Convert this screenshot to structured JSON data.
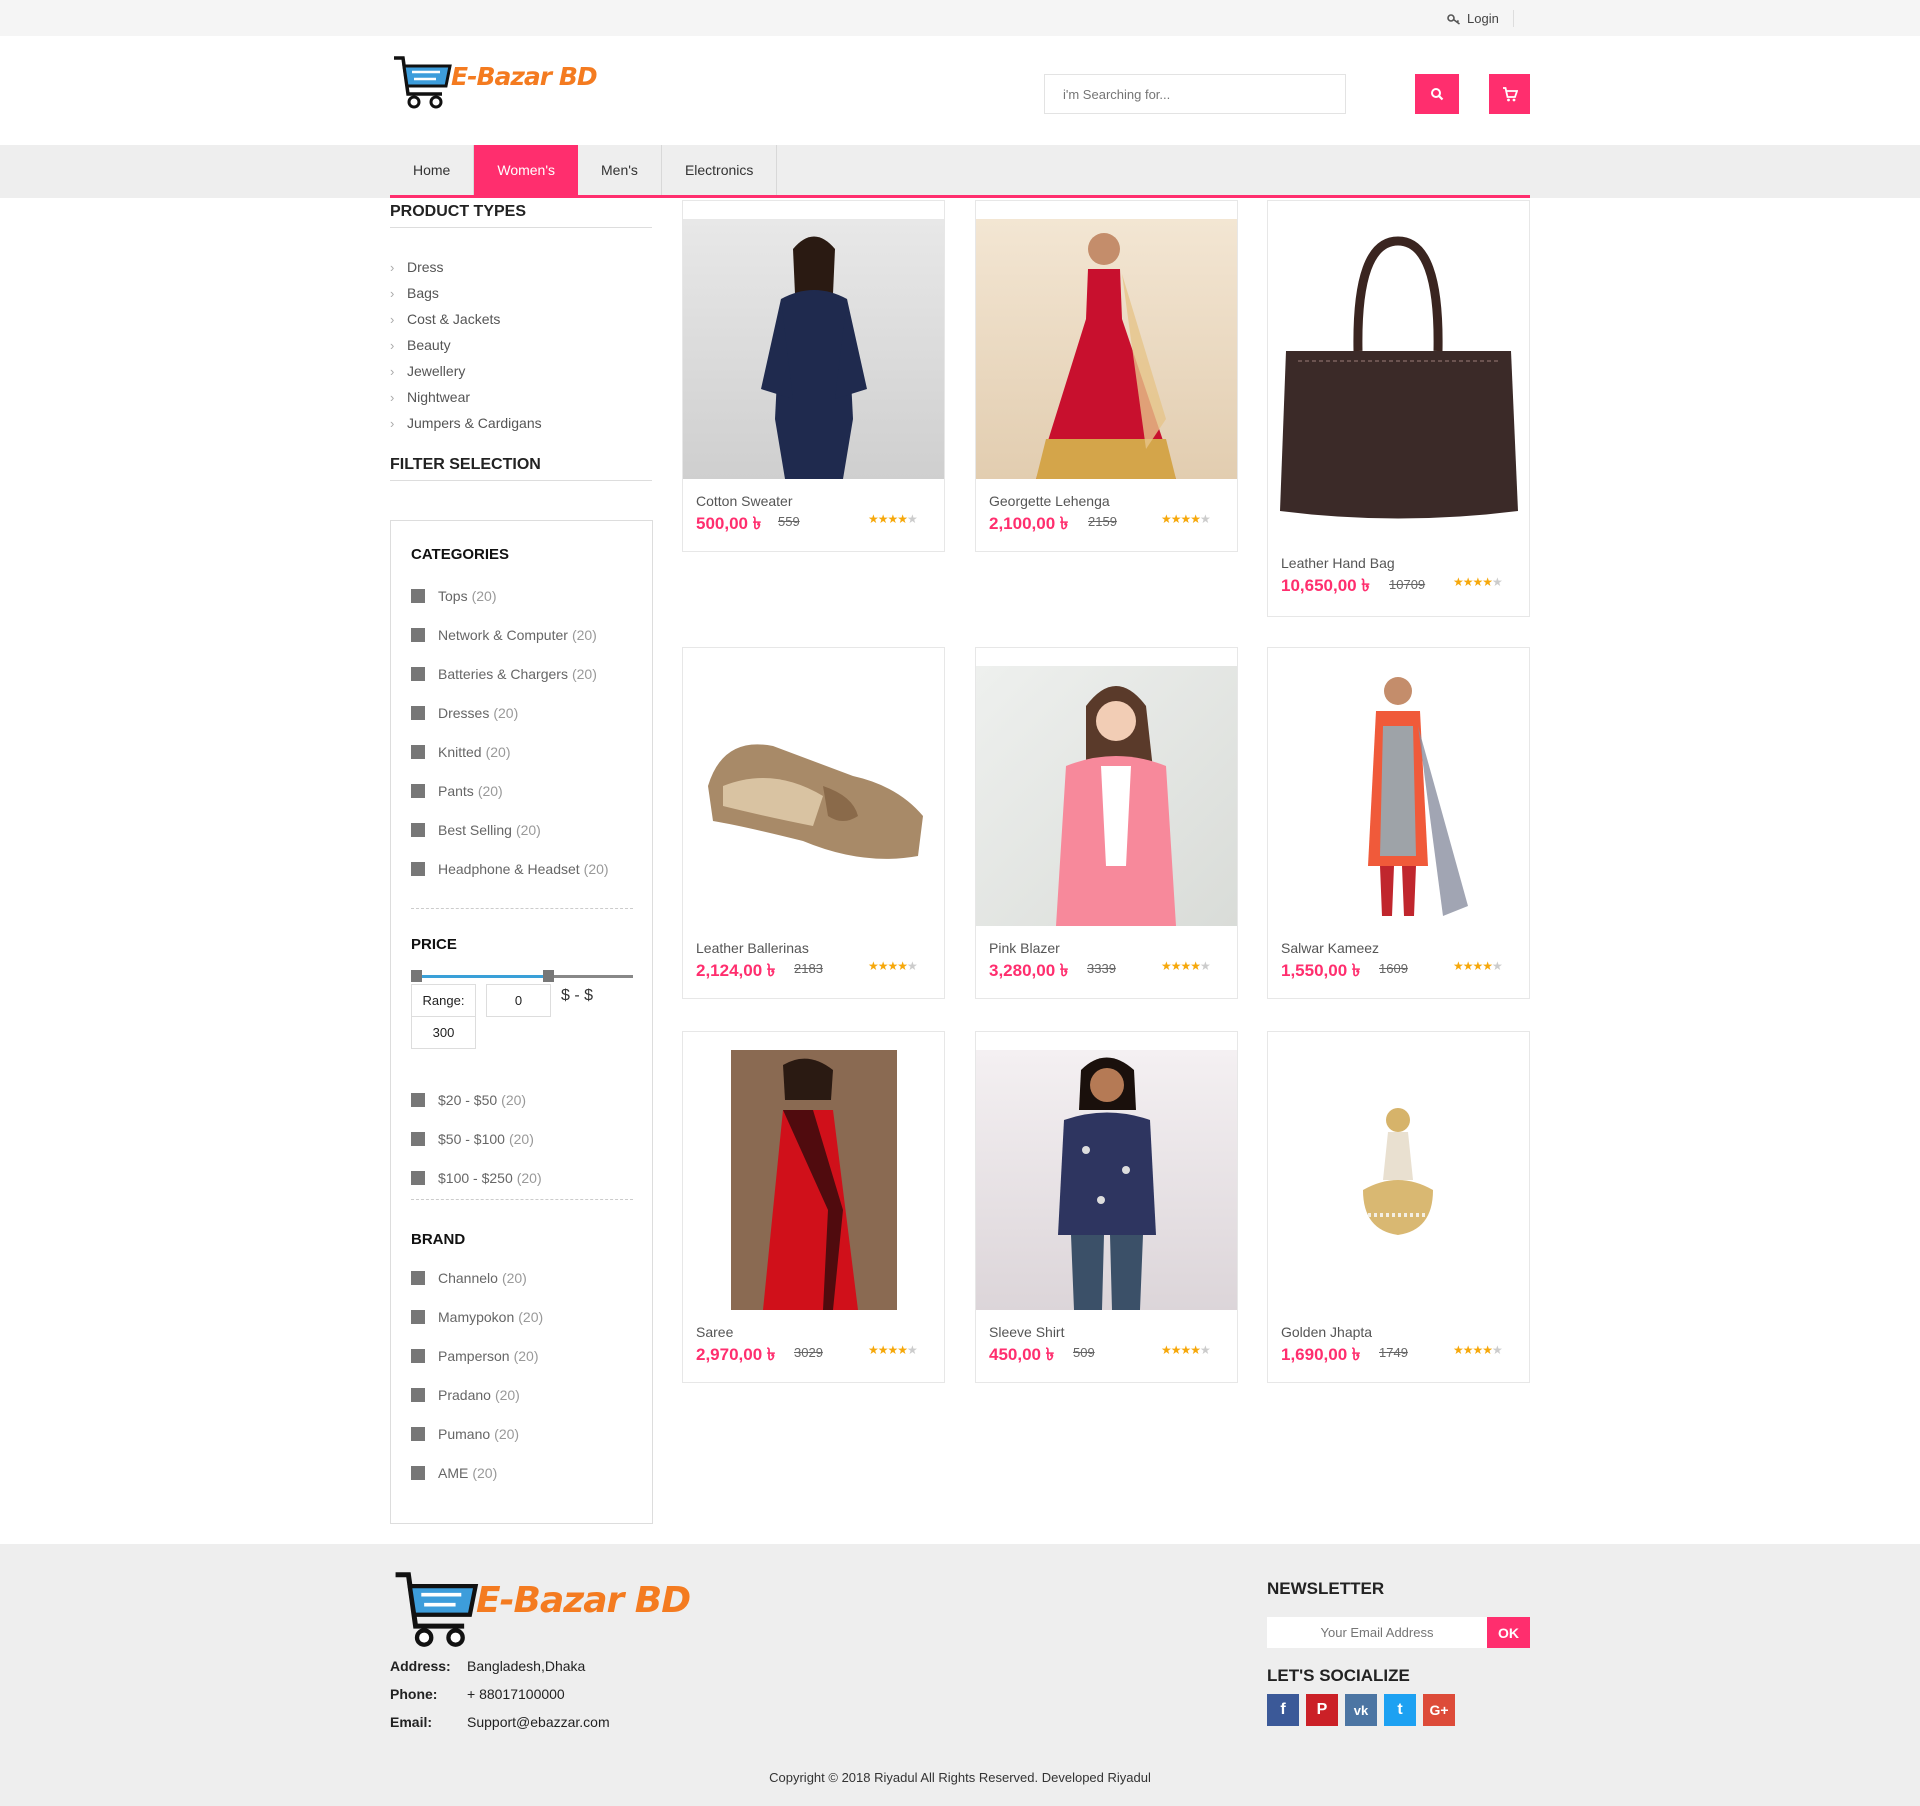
{
  "header": {
    "login_label": "Login",
    "brand": "E-Bazar BD",
    "search_placeholder": "i'm Searching for...",
    "search_icon": "search-icon",
    "cart_icon": "cart-icon"
  },
  "nav": {
    "items": [
      "Home",
      "Women's",
      "Men's",
      "Electronics"
    ],
    "active": "Women's"
  },
  "sidebar": {
    "product_types_title": "PRODUCT TYPES",
    "product_types": [
      "Dress",
      "Bags",
      "Cost & Jackets",
      "Beauty",
      "Jewellery",
      "Nightwear",
      "Jumpers & Cardigans"
    ],
    "filter_title": "FILTER SELECTION",
    "categories_title": "CATEGORIES",
    "categories": [
      {
        "label": "Tops",
        "count": "(20)"
      },
      {
        "label": "Network & Computer",
        "count": "(20)"
      },
      {
        "label": "Batteries & Chargers",
        "count": "(20)"
      },
      {
        "label": "Dresses",
        "count": "(20)"
      },
      {
        "label": "Knitted",
        "count": "(20)"
      },
      {
        "label": "Pants",
        "count": "(20)"
      },
      {
        "label": "Best Selling",
        "count": "(20)"
      },
      {
        "label": "Headphone & Headset",
        "count": "(20)"
      }
    ],
    "price_title": "PRICE",
    "range_label": "Range:",
    "range_min": "0",
    "range_sep": "$ - $",
    "range_max": "300",
    "price_ranges": [
      {
        "label": "$20 - $50",
        "count": "(20)"
      },
      {
        "label": "$50 - $100",
        "count": "(20)"
      },
      {
        "label": "$100 - $250",
        "count": "(20)"
      }
    ],
    "brand_title": "BRAND",
    "brands": [
      {
        "label": "Channelo",
        "count": "(20)"
      },
      {
        "label": "Mamypokon",
        "count": "(20)"
      },
      {
        "label": "Pamperson",
        "count": "(20)"
      },
      {
        "label": "Pradano",
        "count": "(20)"
      },
      {
        "label": "Pumano",
        "count": "(20)"
      },
      {
        "label": "AME",
        "count": "(20)"
      }
    ]
  },
  "products": [
    {
      "name": "Cotton Sweater",
      "price": "500,00 ৳",
      "old": "559",
      "rating": 4
    },
    {
      "name": "Georgette Lehenga",
      "price": "2,100,00 ৳",
      "old": "2159",
      "rating": 4
    },
    {
      "name": "Leather Hand Bag",
      "price": "10,650,00 ৳",
      "old": "10709",
      "rating": 4
    },
    {
      "name": "Leather Ballerinas",
      "price": "2,124,00 ৳",
      "old": "2183",
      "rating": 4
    },
    {
      "name": "Pink Blazer",
      "price": "3,280,00 ৳",
      "old": "3339",
      "rating": 4
    },
    {
      "name": "Salwar Kameez",
      "price": "1,550,00 ৳",
      "old": "1609",
      "rating": 4
    },
    {
      "name": "Saree",
      "price": "2,970,00 ৳",
      "old": "3029",
      "rating": 4
    },
    {
      "name": "Sleeve Shirt",
      "price": "450,00 ৳",
      "old": "509",
      "rating": 4
    },
    {
      "name": "Golden Jhapta",
      "price": "1,690,00 ৳",
      "old": "1749",
      "rating": 4
    }
  ],
  "footer": {
    "brand": "E-Bazar BD",
    "address_label": "Address:",
    "address": "Bangladesh,Dhaka",
    "phone_label": "Phone:",
    "phone": "+ 88017100000",
    "email_label": "Email:",
    "email": "Support@ebazzar.com",
    "newsletter_title": "NEWSLETTER",
    "newsletter_placeholder": "Your Email Address",
    "ok_label": "OK",
    "socialize_title": "LET'S SOCIALIZE",
    "social": [
      {
        "icon": "facebook-icon",
        "glyph": "f",
        "color": "#3b5998"
      },
      {
        "icon": "pinterest-icon",
        "glyph": "P",
        "color": "#cb2027"
      },
      {
        "icon": "vk-icon",
        "glyph": "vk",
        "color": "#4c75a3"
      },
      {
        "icon": "twitter-icon",
        "glyph": "t",
        "color": "#1da1f2"
      },
      {
        "icon": "google-plus-icon",
        "glyph": "G+",
        "color": "#dd4b39"
      }
    ],
    "copyright": "Copyright © 2018 Riyadul All Rights Reserved. Developed Riyadul"
  },
  "colors": {
    "accent": "#ff2e6e",
    "brand": "#f47b20",
    "star": "#f6a80b"
  }
}
